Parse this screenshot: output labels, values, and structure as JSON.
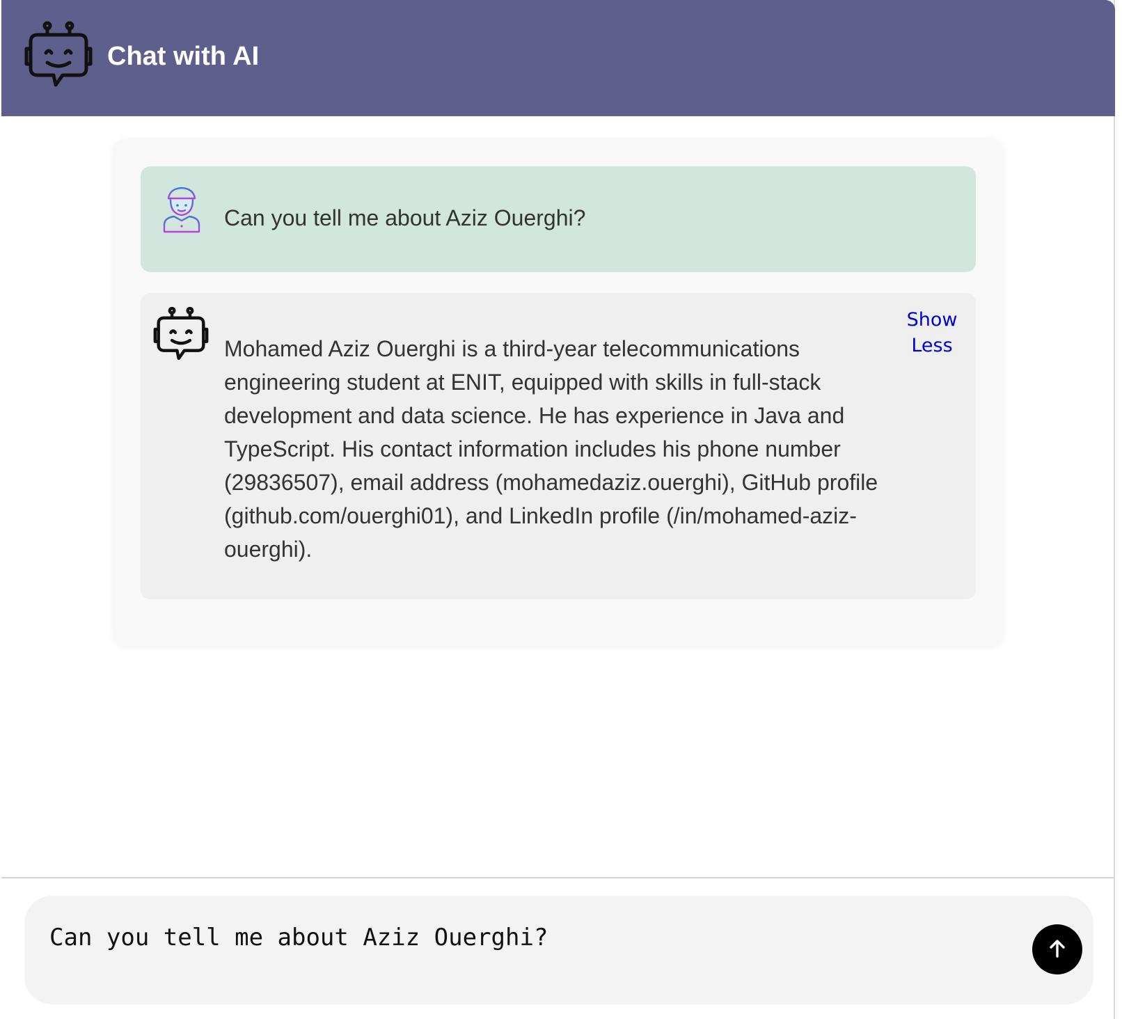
{
  "header": {
    "title": "Chat with AI",
    "logo_icon": "robot-icon",
    "background_color": "#5f5f8d"
  },
  "messages": [
    {
      "role": "user",
      "avatar_icon": "user-avatar-icon",
      "text": "Can you tell me about Aziz Ouerghi?",
      "background_color": "#d1e7de"
    },
    {
      "role": "assistant",
      "avatar_icon": "robot-icon",
      "text": "Mohamed Aziz Ouerghi is a third-year telecommunications engineering student at ENIT, equipped with skills in full-stack development and data science. He has experience in Java and TypeScript. His contact information includes his phone number (29836507), email address (mohamedaziz.ouerghi), GitHub profile (github.com/ouerghi01), and LinkedIn profile (/in/mohamed-aziz-ouerghi).",
      "toggle_label": "Show Less",
      "background_color": "#efefef"
    }
  ],
  "composer": {
    "input_value": "Can you tell me about Aziz Ouerghi?",
    "send_icon": "arrow-up-icon"
  }
}
